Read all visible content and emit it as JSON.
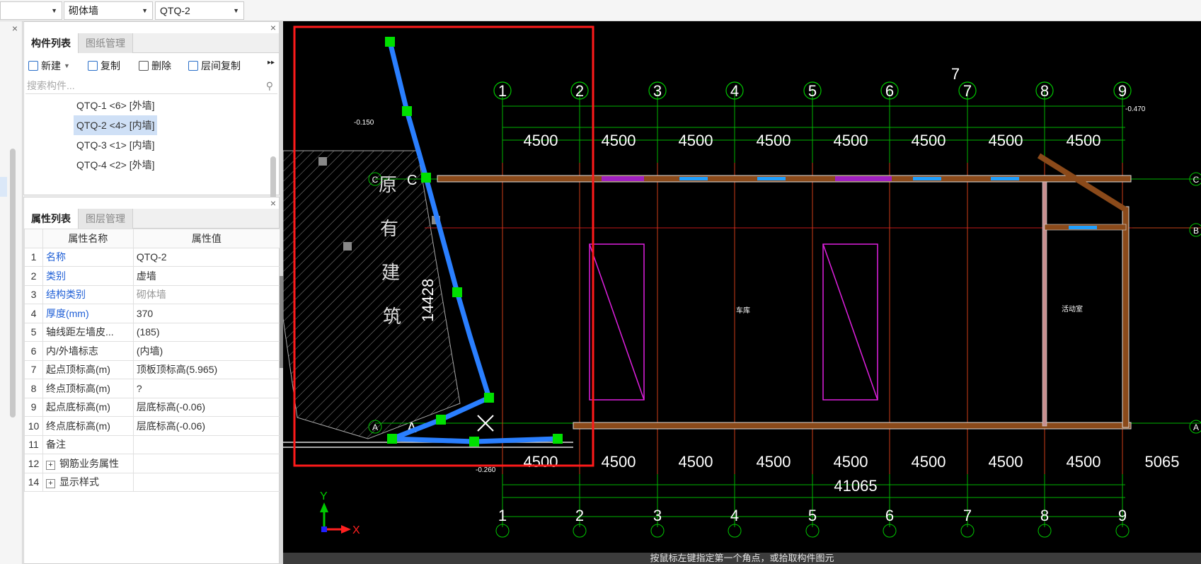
{
  "topbar": {
    "combo_left_value": "",
    "combo_type_value": "砌体墙",
    "combo_component_value": "QTQ-2"
  },
  "component_panel": {
    "tabs": [
      "构件列表",
      "图纸管理"
    ],
    "toolbar": {
      "new": "新建",
      "copy": "复制",
      "delete": "删除",
      "floor_copy": "层间复制"
    },
    "search_placeholder": "搜索构件...",
    "items": [
      "QTQ-1 <6> [外墙]",
      "QTQ-2 <4> [内墙]",
      "QTQ-3 <1> [内墙]",
      "QTQ-4 <2> [外墙]"
    ],
    "selected_index": 1
  },
  "property_panel": {
    "tabs": [
      "属性列表",
      "图层管理"
    ],
    "header": {
      "name": "属性名称",
      "value": "属性值"
    },
    "rows": [
      {
        "no": "1",
        "name": "名称",
        "value": "QTQ-2"
      },
      {
        "no": "2",
        "name": "类别",
        "value": "虚墙"
      },
      {
        "no": "3",
        "name": "结构类别",
        "value": "砌体墙"
      },
      {
        "no": "4",
        "name": "厚度(mm)",
        "value": "370"
      },
      {
        "no": "5",
        "name": "轴线距左墙皮...",
        "value": "(185)"
      },
      {
        "no": "6",
        "name": "内/外墙标志",
        "value": "(内墙)"
      },
      {
        "no": "7",
        "name": "起点顶标高(m)",
        "value": "顶板顶标高(5.965)"
      },
      {
        "no": "8",
        "name": "终点顶标高(m)",
        "value": "?"
      },
      {
        "no": "9",
        "name": "起点底标高(m)",
        "value": "层底标高(-0.06)"
      },
      {
        "no": "10",
        "name": "终点底标高(m)",
        "value": "层底标高(-0.06)"
      },
      {
        "no": "11",
        "name": "备注",
        "value": ""
      },
      {
        "no": "12",
        "name": "钢筋业务属性",
        "value": ""
      },
      {
        "no": "14",
        "name": "显示样式",
        "value": ""
      }
    ]
  },
  "drawing": {
    "axis_labels": [
      "1",
      "2",
      "3",
      "4",
      "5",
      "6",
      "7",
      "8",
      "9"
    ],
    "row_labels": [
      "C",
      "B",
      "A"
    ],
    "bay_dim": "4500",
    "last_bay_dim": "5065",
    "total_dim": "41065",
    "vertical_dim": "14428",
    "old_building_text": [
      "原",
      "有",
      "建",
      "筑"
    ],
    "axis_y": "Y",
    "axis_x": "X",
    "small_labels": {
      "elev_top_left": "-0.150",
      "elev_bottom_left": "-0.260",
      "elev_right": "-0.470",
      "room_a": "车库",
      "room_b": "活动室",
      "extra_seven": "7"
    }
  },
  "status_text": "按鼠标左键指定第一个角点，或拾取构件图元",
  "colors": {
    "accent": "#1f5fd6",
    "selection_red": "#ff1a1a",
    "cad_green": "#00c800",
    "wall_blue": "#2a7fff"
  }
}
